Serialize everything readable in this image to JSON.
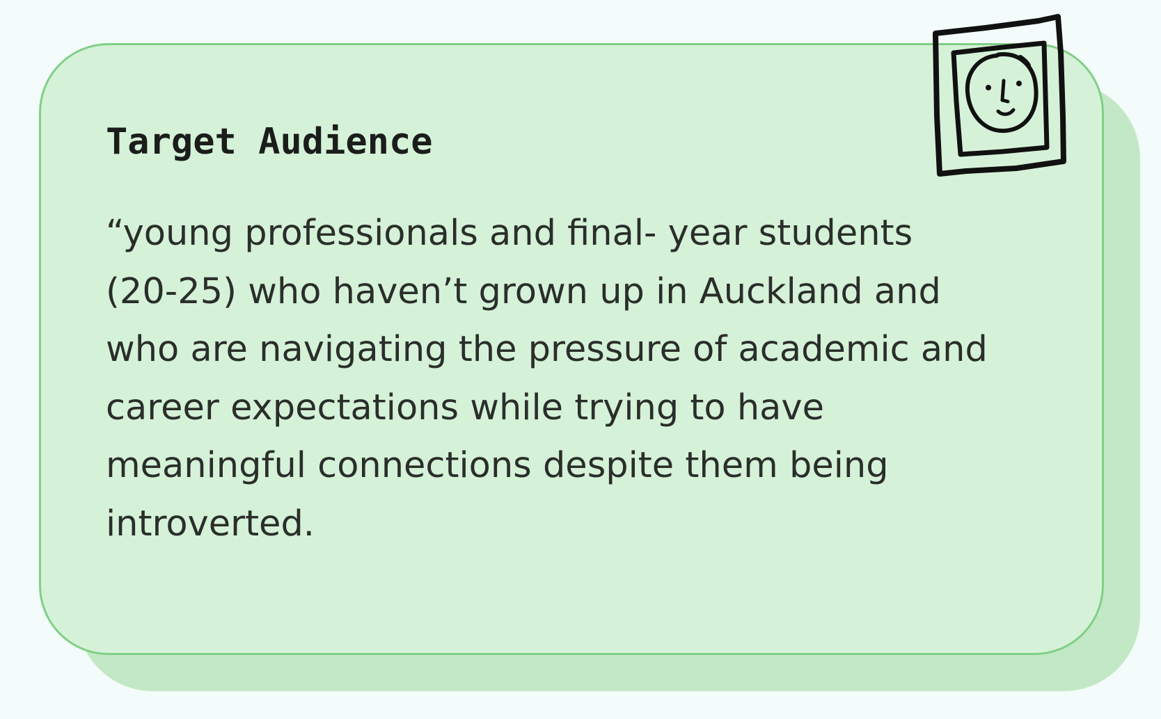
{
  "card": {
    "title": "Target Audience",
    "body_lines": [
      "“young professionals and final- year students",
      "(20-25) who haven’t grown up in Auckland and",
      "who are navigating the pressure of academic and",
      "career expectations while trying to have",
      "meaningful connections despite them being",
      "introverted."
    ],
    "icon": "framed-portrait-icon"
  },
  "colors": {
    "background": "#f3fcfa",
    "card_fill": "#d5f2d8",
    "card_border": "#80cf86",
    "card_shadow": "#c3e8c5",
    "text": "#2a2e2a",
    "ink": "#111111"
  }
}
